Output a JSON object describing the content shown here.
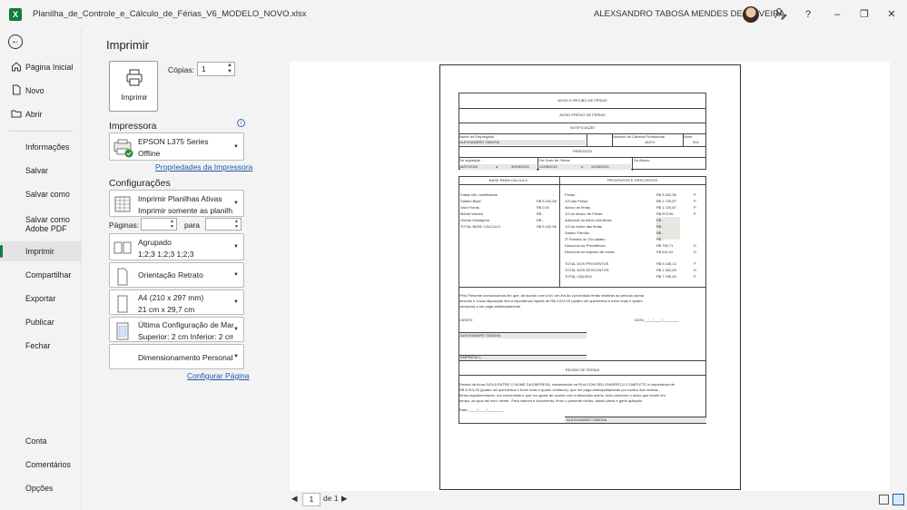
{
  "window": {
    "file_name": "Planilha_de_Controle_e_Cálculo_de_Férias_V6_MODELO_NOVO.xlsx",
    "user_name": "ALEXSANDRO TABOSA MENDES DE OLIVEIRA",
    "help_glyph": "?",
    "min_glyph": "–",
    "max_glyph": "❐",
    "close_glyph": "✕"
  },
  "nav": {
    "back_glyph": "←",
    "items": [
      {
        "label": "Página Inicial",
        "icon": "home-icon"
      },
      {
        "label": "Novo",
        "icon": "new-document-icon"
      },
      {
        "label": "Abrir",
        "icon": "folder-icon"
      },
      {
        "label": "Informações"
      },
      {
        "label": "Salvar"
      },
      {
        "label": "Salvar como"
      },
      {
        "label": "Salvar como Adobe PDF"
      },
      {
        "label": "Imprimir"
      },
      {
        "label": "Compartilhar"
      },
      {
        "label": "Exportar"
      },
      {
        "label": "Publicar"
      },
      {
        "label": "Fechar"
      },
      {
        "label": "Conta"
      },
      {
        "label": "Comentários"
      },
      {
        "label": "Opções"
      }
    ]
  },
  "print": {
    "title": "Imprimir",
    "button_label": "Imprimir",
    "copies_label": "Cópias:",
    "copies_value": "1",
    "printer_header": "Impressora",
    "printer_name": "EPSON L375 Series",
    "printer_status": "Offline",
    "printer_properties": "Propriedades da Impressora",
    "settings_header": "Configurações",
    "what_title": "Imprimir Planilhas Ativas",
    "what_sub": "Imprimir somente as planilh...",
    "pages_label": "Páginas:",
    "to_label": "para",
    "collate_title": "Agrupado",
    "collate_sub": "1;2;3    1;2;3    1;2;3",
    "orientation": "Orientação Retrato",
    "paper_title": "A4 (210 x 297 mm)",
    "paper_sub": "21 cm x 29,7 cm",
    "margins_title": "Última Configuração de Mar...",
    "margins_sub": "Superior: 2 cm Inferior: 2 cm...",
    "scaling": "Dimensionamento Personali...",
    "page_setup": "Configurar Página",
    "current_page": "1",
    "of_pages": "de 1",
    "info_glyph": "i",
    "caret_glyph": "▼",
    "spin_up": "▲",
    "spin_down": "▼",
    "prev_glyph": "◀",
    "next_glyph": "▶"
  },
  "sheet": {
    "h1": "AVISO E RECIBO DE FÉRIAS",
    "h2": "AVISO PRÉVIO DE FÉRIAS",
    "h3": "NOTIFICAÇÃO",
    "emp_label": "Nome do Empregado",
    "emp_value": "ALEXSANDRO TABOSA",
    "ctps_label": "Número da Carteira Profissional",
    "ctps_value": "48474",
    "serie_label": "Série",
    "serie_value": "534",
    "periodo": "PERÍODOS",
    "aq_label": "De aquisição",
    "aq_from": "06/07/2020",
    "aq_a": "a",
    "aq_to": "30/06/2021",
    "goz_label": "De Gozo de Férias",
    "goz_from": "01/06/2021",
    "goz_to": "31/06/2021",
    "abono_label": "De Abono",
    "base": "BASE PARA CÁLCULO",
    "proventos": "PROVENTOS E DESCONTOS",
    "faltas": "Faltas não Justificadas",
    "faltas_v": "-",
    "salario": "Salário Base",
    "salario_v": "R$   5.162,58",
    "vale": "Valor Horas",
    "vale_v": "R$     0,00",
    "media": "Média Valores",
    "media_v": "R$        -",
    "outras": "Outras Vantagens",
    "outras_v": "R$        -",
    "total_base": "TOTAL BASE CÁLCULO",
    "total_base_v": "R$   5.162,58",
    "p1": "Férias",
    "p1_v": "R$   5.162,58",
    "p1_f": "P",
    "p2": "1/3 das Férias",
    "p2_v": "R$   1.720,87",
    "p2_f": "P",
    "p3": "Abono de férias",
    "p3_v": "R$   1.720,87",
    "p3_f": "P",
    "p4": "1/3 do Abono de Férias",
    "p4_v": "R$     573,96",
    "p4_f": "P",
    "p5": "Adicional do dobro das férias",
    "p5_v": "R$        -",
    "p6": "1/3 do dobro das férias",
    "p6_v": "R$        -",
    "p7": "Salário Família",
    "p7_v": "R$        -",
    "p8": "1ª Parcela do 13o salário",
    "p8_v": "R$        -",
    "p9": "Desconto da Previdência",
    "p9_v": "R$     750,71",
    "p9_f": "D",
    "p10": "Desconto do imposto de renda",
    "p10_v": "R$     641,92",
    "p10_f": "D",
    "t1": "TOTAL DOS PROVENTOS",
    "t1_v": "R$   9.158,13",
    "t1_f": "P",
    "t2": "TOTAL DOS DESCONTOS",
    "t2_v": "R$   1.392,63",
    "t2_f": "D",
    "t3": "TOTAL LÍQUIDO",
    "t3_v": "R$   7.765,50",
    "t3_f": "P",
    "para1": "Pelo Presente comunicamos-lhe que, de acordo com a lei, ser-lhe-ão concedidas férias relativas ao período acima",
    "para2": "descrito e à sua disposição fica a importância líquida de R$ 4.513,00 (quatro mil quinhentos e treze reais e quatro",
    "para3": "centavos) a ser paga adiantadamente.",
    "ciente": "CIENTE",
    "data": "DATA ____/____/________",
    "sig1": "ALEXSANDRO TABOSA",
    "empresa": "EMPRESA 1",
    "recibo": "RECIBO DE FÉRIAS",
    "rec1": "Recebi da firma SIGLA ENTRE O NOME DA EMPRESA, estabelecida na RUA COM SEU ENDEREÇO COMPLETO a importância de",
    "rec2": "R$ 4.513,00 (quatro mil quinhentos e treze reais e quatro centavos), que me paga antecipadamente por motivo das minhas",
    "rec3": "férias regulamentares, ora concedidas e que vou gozar de acordo com a descrição acima, tudo conforme o aviso que recebi em",
    "rec4": "tempo, ao qual dei meu 'ciente'. Para clareza e documento, firmo o presente recibo, dando plena e geral quitação.",
    "data2": "Data: ____/____/________",
    "sig2": "ALEXSANDRO TABOSA"
  }
}
